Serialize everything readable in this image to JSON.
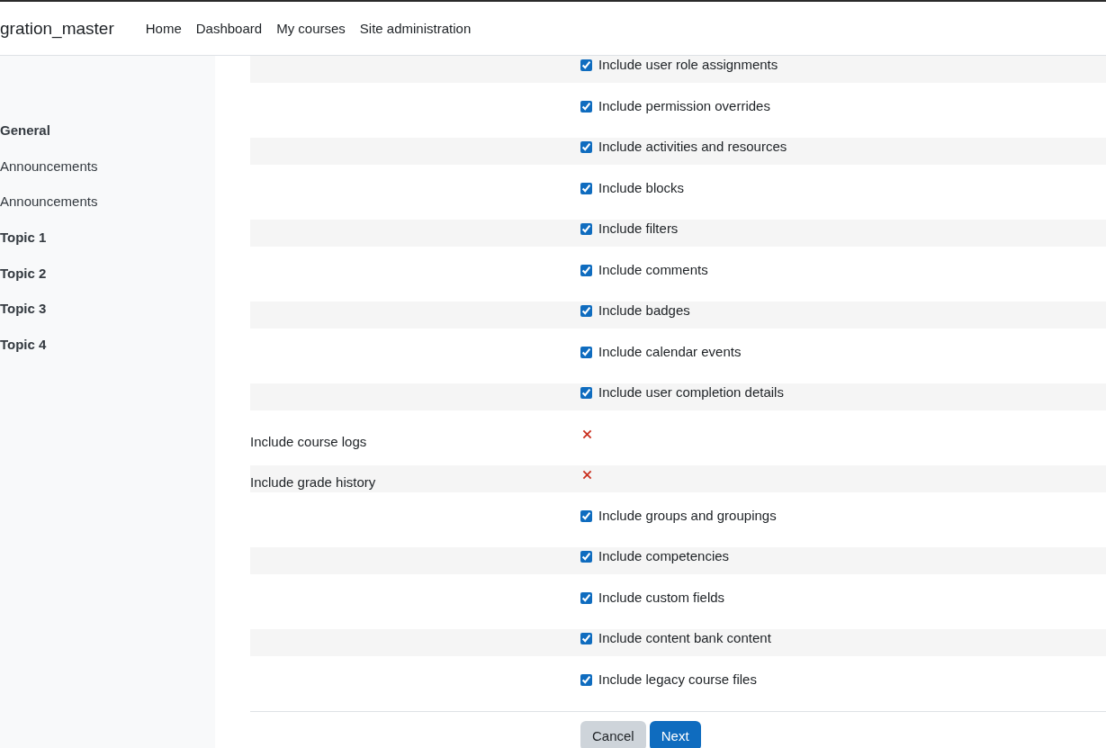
{
  "navbar": {
    "site_name": "gration_master",
    "links": [
      "Home",
      "Dashboard",
      "My courses",
      "Site administration"
    ]
  },
  "sidebar": {
    "items": [
      {
        "label": "General",
        "kind": "section"
      },
      {
        "label": "Announcements",
        "kind": "activity"
      },
      {
        "label": "Announcements",
        "kind": "activity"
      },
      {
        "label": "Topic 1",
        "kind": "section"
      },
      {
        "label": "Topic 2",
        "kind": "section"
      },
      {
        "label": "Topic 3",
        "kind": "section"
      },
      {
        "label": "Topic 4",
        "kind": "section"
      }
    ]
  },
  "settings": [
    {
      "kind": "checkbox",
      "label": "Include user role assignments",
      "checked": true
    },
    {
      "kind": "checkbox",
      "label": "Include permission overrides",
      "checked": true
    },
    {
      "kind": "checkbox",
      "label": "Include activities and resources",
      "checked": true
    },
    {
      "kind": "checkbox",
      "label": "Include blocks",
      "checked": true
    },
    {
      "kind": "checkbox",
      "label": "Include filters",
      "checked": true
    },
    {
      "kind": "checkbox",
      "label": "Include comments",
      "checked": true
    },
    {
      "kind": "checkbox",
      "label": "Include badges",
      "checked": true
    },
    {
      "kind": "checkbox",
      "label": "Include calendar events",
      "checked": true
    },
    {
      "kind": "checkbox",
      "label": "Include user completion details",
      "checked": true
    },
    {
      "kind": "status",
      "label": "Include course logs",
      "included": false
    },
    {
      "kind": "status",
      "label": "Include grade history",
      "included": false
    },
    {
      "kind": "checkbox",
      "label": "Include groups and groupings",
      "checked": true
    },
    {
      "kind": "checkbox",
      "label": "Include competencies",
      "checked": true
    },
    {
      "kind": "checkbox",
      "label": "Include custom fields",
      "checked": true
    },
    {
      "kind": "checkbox",
      "label": "Include content bank content",
      "checked": true
    },
    {
      "kind": "checkbox",
      "label": "Include legacy course files",
      "checked": true
    }
  ],
  "buttons": [
    {
      "label": "Cancel",
      "kind": "secondary"
    },
    {
      "label": "Next",
      "kind": "primary"
    }
  ]
}
